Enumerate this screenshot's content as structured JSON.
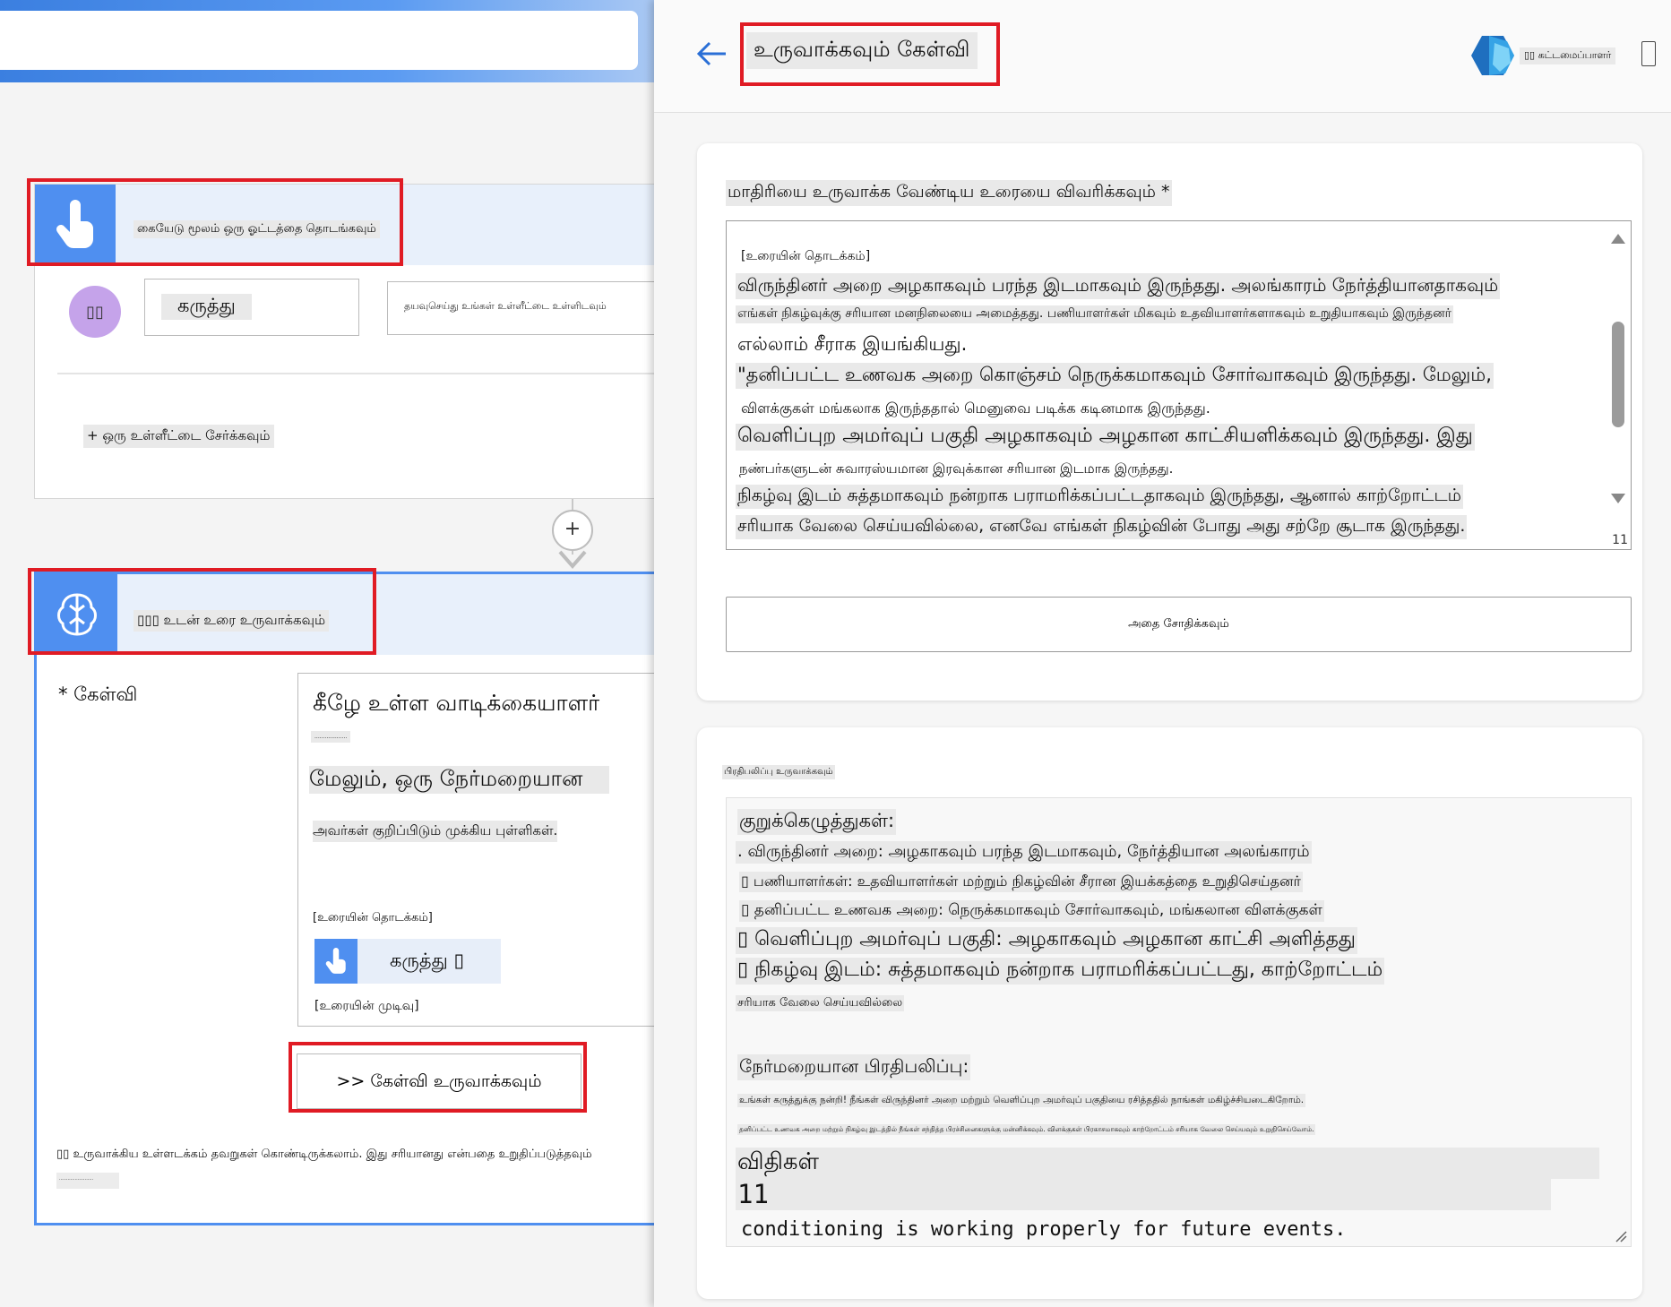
{
  "left": {
    "trigger": {
      "title": "கையேடு மூலம் ஒரு ஓட்டத்தை தொடங்கவும்",
      "avatar_text": "▯▯",
      "input_label": "கருத்து",
      "input_hint": "தயவுசெய்து உங்கள் உள்ளீட்டை உள்ளிடவும்",
      "add_input": "+ ஒரு உள்ளீட்டை சேர்க்கவும்"
    },
    "connector": {
      "plus": "+"
    },
    "ai": {
      "title": "▯▯▯ உடன் உரை உருவாக்கவும்",
      "prompt_label": "* கேள்வி",
      "prompt_line1": "கீழே உள்ள வாடிக்கையாளர்",
      "prompt_tiny": "...................",
      "prompt_line2": "மேலும், ஒரு நேர்மறையான",
      "prompt_line3": "அவர்கள் குறிப்பிடும் முக்கிய புள்ளிகள்.",
      "text_start": "[உரையின் தொடக்கம்]",
      "chip_label": "கருத்து ▯",
      "text_end": "[உரையின் முடிவு]",
      "generate_button": ">> கேள்வி உருவாக்கவும்",
      "disclaimer": "▯▯ உருவாக்கிய உள்ளடக்கம் தவறுகள் கொண்டிருக்கலாம். இது சரியானது என்பதை உறுதிப்படுத்தவும்",
      "disclaimer_tiny": "........................"
    }
  },
  "panel": {
    "title": "உருவாக்கவும் கேள்வி",
    "brand_text": "▯▯ கட்டமைப்பாளர்",
    "description_label": "மாதிரியை உருவாக்க வேண்டிய உரையை விவரிக்கவும் *",
    "textarea_lines": [
      "[உரையின் தொடக்கம்]",
      "விருந்தினர் அறை அழகாகவும் பரந்த இடமாகவும் இருந்தது. அலங்காரம் நேர்த்தியானதாகவும்",
      "எங்கள் நிகழ்வுக்கு சரியான மனநிலையை அமைத்தது. பணியாளர்கள் மிகவும் உதவியாளர்களாகவும் உறுதியாகவும் இருந்தனர்",
      "எல்லாம் சீராக இயங்கியது.",
      "\"தனிப்பட்ட உணவக அறை கொஞ்சம் நெருக்கமாகவும் சோர்வாகவும் இருந்தது. மேலும்,",
      "விளக்குகள் மங்கலாக இருந்ததால் மெனுவை படிக்க கடினமாக இருந்தது.",
      "வெளிப்புற அமர்வுப் பகுதி அழகாகவும் அழகான காட்சியளிக்கவும் இருந்தது. இது",
      "நண்பர்களுடன் சுவாரஸ்யமான இரவுக்கான சரியான இடமாக இருந்தது.",
      "நிகழ்வு இடம் சுத்தமாகவும் நன்றாக பராமரிக்கப்பட்டதாகவும் இருந்தது, ஆனால் காற்றோட்டம்",
      "சரியாக வேலை செய்யவில்லை, எனவே எங்கள் நிகழ்வின் போது அது சற்றே சூடாக இருந்தது."
    ],
    "textarea_counter": "11",
    "test_button": "அதை சோதிக்கவும்",
    "response_label": "பிரதிபலிப்பு உருவாக்கவும்",
    "response_lines": [
      "குறுக்கெழுத்துகள்:",
      ". விருந்தினர் அறை: அழகாகவும் பரந்த இடமாகவும், நேர்த்தியான அலங்காரம்",
      "▯ பணியாளர்கள்: உதவியாளர்கள் மற்றும் நிகழ்வின் சீரான இயக்கத்தை உறுதிசெய்தனர்",
      "▯ தனிப்பட்ட உணவக அறை: நெருக்கமாகவும் சோர்வாகவும், மங்கலான விளக்குகள்",
      "▯ வெளிப்புற அமர்வுப் பகுதி: அழகாகவும் அழகான காட்சி அளித்தது",
      "▯ நிகழ்வு இடம்: சுத்தமாகவும் நன்றாக பராமரிக்கப்பட்டது, காற்றோட்டம்",
      "சரியாக வேலை செய்யவில்லை",
      "நேர்மறையான பிரதிபலிப்பு:",
      "உங்கள் கருத்துக்கு நன்றி! நீங்கள் விருந்தினர் அறை மற்றும் வெளிப்புற அமர்வுப் பகுதியை ரசித்ததில் நாங்கள் மகிழ்ச்சியடைகிறோம்.",
      "தனிப்பட்ட உணவக அறை மற்றும் நிகழ்வு இடத்தில் நீங்கள் சந்தித்த பிரச்சினைகளுக்கு மன்னிக்கவும். விளக்குகள் பிரகாசமாகவும் காற்றோட்டம் சரியாக வேலை செய்யவும் உறுதிசெய்வோம்.",
      "விதிகள்",
      "11",
      "conditioning is working properly for future events."
    ]
  },
  "colors": {
    "accent": "#4f8ff0",
    "highlight": "#e01b24"
  }
}
